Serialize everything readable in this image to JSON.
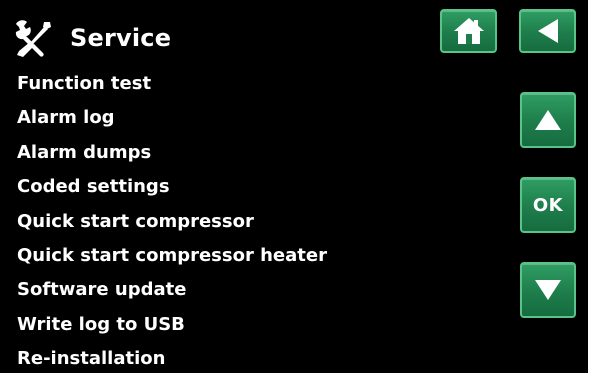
{
  "header": {
    "title": "Service",
    "icon": "tools-icon"
  },
  "buttons": {
    "home_icon": "home-icon",
    "back_icon": "back-arrow-icon",
    "up_icon": "up-arrow-icon",
    "ok_label": "OK",
    "down_icon": "down-arrow-icon"
  },
  "menu": {
    "items": [
      "Function test",
      "Alarm log",
      "Alarm dumps",
      "Coded settings",
      "Quick start compressor",
      "Quick start compressor heater",
      "Software update",
      "Write log to USB",
      "Re-installation"
    ]
  },
  "colors": {
    "background": "#000000",
    "text": "#ffffff",
    "button_green": "#1e7d4b",
    "button_border": "#59c487"
  }
}
